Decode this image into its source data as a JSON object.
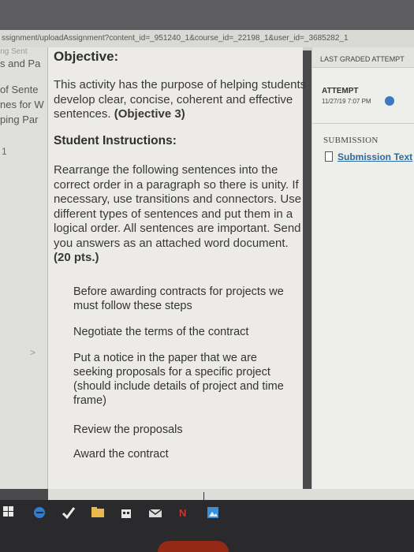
{
  "browser": {
    "url": "ssignment/uploadAssignment?content_id=_951240_1&course_id=_22198_1&user_id=_3685282_1",
    "tab_fragment": "ing Sent"
  },
  "sidebar": {
    "items": [
      "s and Pa",
      "of Sente",
      "nes for W",
      "ping Par"
    ],
    "marker": "1",
    "chevron": ">"
  },
  "main": {
    "objective_title": "Objective:",
    "objective_text": "This activity has the purpose of helping students develop clear, concise, coherent and effective sentences.",
    "objective_ref": "(Objective 3)",
    "instructions_title": "Student Instructions:",
    "instructions_text": "Rearrange the following sentences into the correct order in a paragraph so there is unity. If necessary, use transitions and connectors. Use different types of sentences and put them in a logical order. All sentences are important. Send you answers as an attached word document.",
    "instructions_points": "(20 pts.)",
    "sentences": [
      "Before awarding contracts for projects we must follow these steps",
      "Negotiate the terms of the contract",
      "Put a notice in the paper that we are seeking proposals for a specific project (should include details of project and time frame)",
      "Review the proposals",
      "Award the contract"
    ]
  },
  "rightpanel": {
    "header": "LAST GRADED ATTEMPT",
    "attempt_label": "ATTEMPT",
    "attempt_date": "11/27/19 7:07 PM",
    "submission_label": "SUBMISSION",
    "submission_link": "Submission Text"
  },
  "taskbar": {
    "icons": [
      "start-icon",
      "edge-icon",
      "checkmark-icon",
      "file-explorer-icon",
      "store-icon",
      "mail-icon",
      "onenote-icon",
      "photos-icon"
    ]
  }
}
